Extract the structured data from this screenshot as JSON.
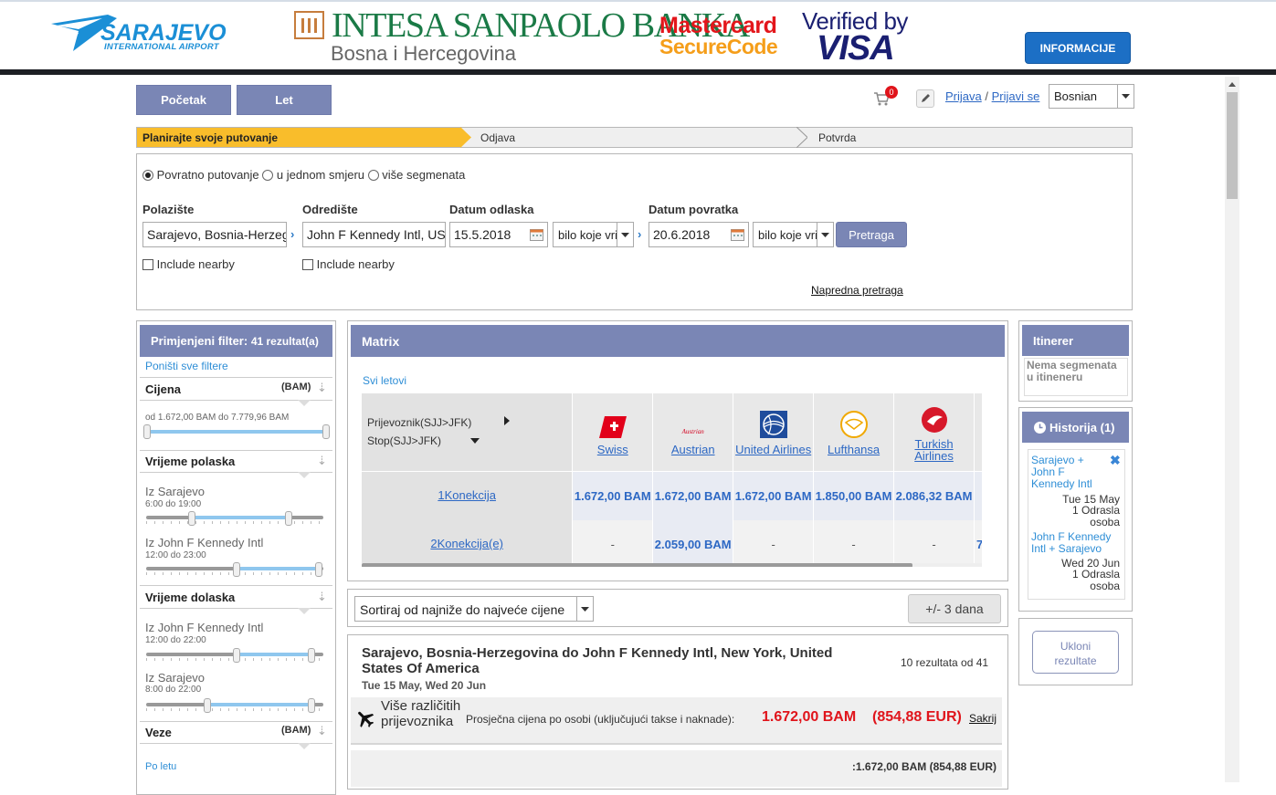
{
  "banner": {
    "logo_main": "SARAJEVO",
    "logo_sub": "INTERNATIONAL AIRPORT",
    "bank_name": "INTESA SANPAOLO BANKA",
    "bank_sub": "Bosna i Hercegovina",
    "mastercard_1": "Mastercard",
    "mastercard_2": "SecureCode",
    "visa_1": "Verified by",
    "visa_2": "VISA",
    "info_button": "INFORMACIJE"
  },
  "nav": {
    "home": "Početak",
    "flight": "Let",
    "cart_count": "0",
    "login": "Prijava",
    "separator": "/",
    "signup": "Prijavi se",
    "language": "Bosnian"
  },
  "steps": [
    "Planirajte svoje putovanje",
    "Odjava",
    "Potvrda"
  ],
  "search": {
    "trip_types": [
      "Povratno putovanje",
      "u jednom smjeru",
      "više segmenata"
    ],
    "origin_label": "Polazište",
    "origin_value": "Sarajevo, Bosnia-Herzegovina",
    "dest_label": "Odredište",
    "dest_value": "John F Kennedy Intl, USA",
    "depart_label": "Datum odlaska",
    "depart_value": "15.5.2018",
    "depart_time": "bilo koje vrijeme",
    "return_label": "Datum povratka",
    "return_value": "20.6.2018",
    "return_time": "bilo koje vrijeme",
    "search_button": "Pretraga",
    "include_nearby": "Include nearby",
    "advanced": "Napredna pretraga"
  },
  "filters": {
    "header_label": "Primjenjeni filter:",
    "header_count": "41 rezultat(a)",
    "reset": "Poništi sve filtere",
    "price_title": "Cijena",
    "price_unit": "(BAM)",
    "price_range": "od 1.672,00 BAM do 7.779,96 BAM",
    "departure_title": "Vrijeme polaska",
    "dep_from_1": "Iz Sarajevo",
    "dep_range_1": "6:00 do 19:00",
    "dep_from_2": "Iz John F Kennedy Intl",
    "dep_range_2": "12:00 do 23:00",
    "arrival_title": "Vrijeme dolaska",
    "arr_from_1": "Iz John F Kennedy Intl",
    "arr_range_1": "12:00 do 22:00",
    "arr_from_2": "Iz Sarajevo",
    "arr_range_2": "8:00 do 22:00",
    "connections_title": "Veze",
    "connections_unit": "(BAM)",
    "per_flight": "Po letu"
  },
  "matrix": {
    "title": "Matrix",
    "all_flights": "Svi letovi",
    "row_header_1": "Prijevoznik(SJJ>JFK)",
    "row_header_2": "Stop(SJJ>JFK)",
    "airlines": [
      {
        "name": "Swiss",
        "logo": "swiss-cross"
      },
      {
        "name": "Austrian",
        "logo": "austrian-text",
        "logo_text": "Austrian"
      },
      {
        "name": "United Airlines",
        "logo": "united-globe"
      },
      {
        "name": "Lufthansa",
        "logo": "lufthansa-crane"
      },
      {
        "name": "Turkish Airlines",
        "logo": "turkish-bird"
      }
    ],
    "rows": [
      {
        "label": "1Konekcija",
        "values": [
          "1.672,00 BAM",
          "1.672,00 BAM",
          "1.672,00 BAM",
          "1.850,00 BAM",
          "2.086,32 BAM"
        ]
      },
      {
        "label": "2Konekcija(e)",
        "values": [
          "-",
          "2.059,00 BAM",
          "-",
          "-",
          "-"
        ]
      }
    ],
    "overflow_char": "7"
  },
  "sort": {
    "value": "Sortiraj od najniže do najveće cijene",
    "range_button": "+/- 3 dana"
  },
  "result": {
    "title": "Sarajevo, Bosnia-Herzegovina do John F Kennedy Intl, New York, United States Of America",
    "count": "10 rezultata od 41",
    "dates": "Tue 15 May, Wed 20 Jun",
    "carriers": "Više različitih prijevoznika",
    "avg_label": "Prosječna cijena po osobi (uključujući takse i naknade):",
    "price_bam": "1.672,00 BAM",
    "price_eur": "(854,88 EUR)",
    "hide": "Sakrij",
    "total_prefix": ":",
    "total": "1.672,00 BAM (854,88 EUR)"
  },
  "itinerary": {
    "title": "Itinerer",
    "empty": "Nema segmenata u itineneru"
  },
  "history": {
    "title": "Historija (1)",
    "seg1_route": "Sarajevo + John F Kennedy Intl",
    "seg1_date": "Tue 15 May",
    "seg1_pax": "1 Odrasla osoba",
    "seg2_route": "John F Kennedy Intl + Sarajevo",
    "seg2_date": "Wed 20 Jun",
    "seg2_pax": "1 Odrasla osoba"
  },
  "remove_button": "Ukloni rezultate",
  "colors": {
    "accent": "#7a86b5",
    "step_active": "#f9bd2b",
    "link": "#2d68c4",
    "price_red": "#e0141b"
  }
}
